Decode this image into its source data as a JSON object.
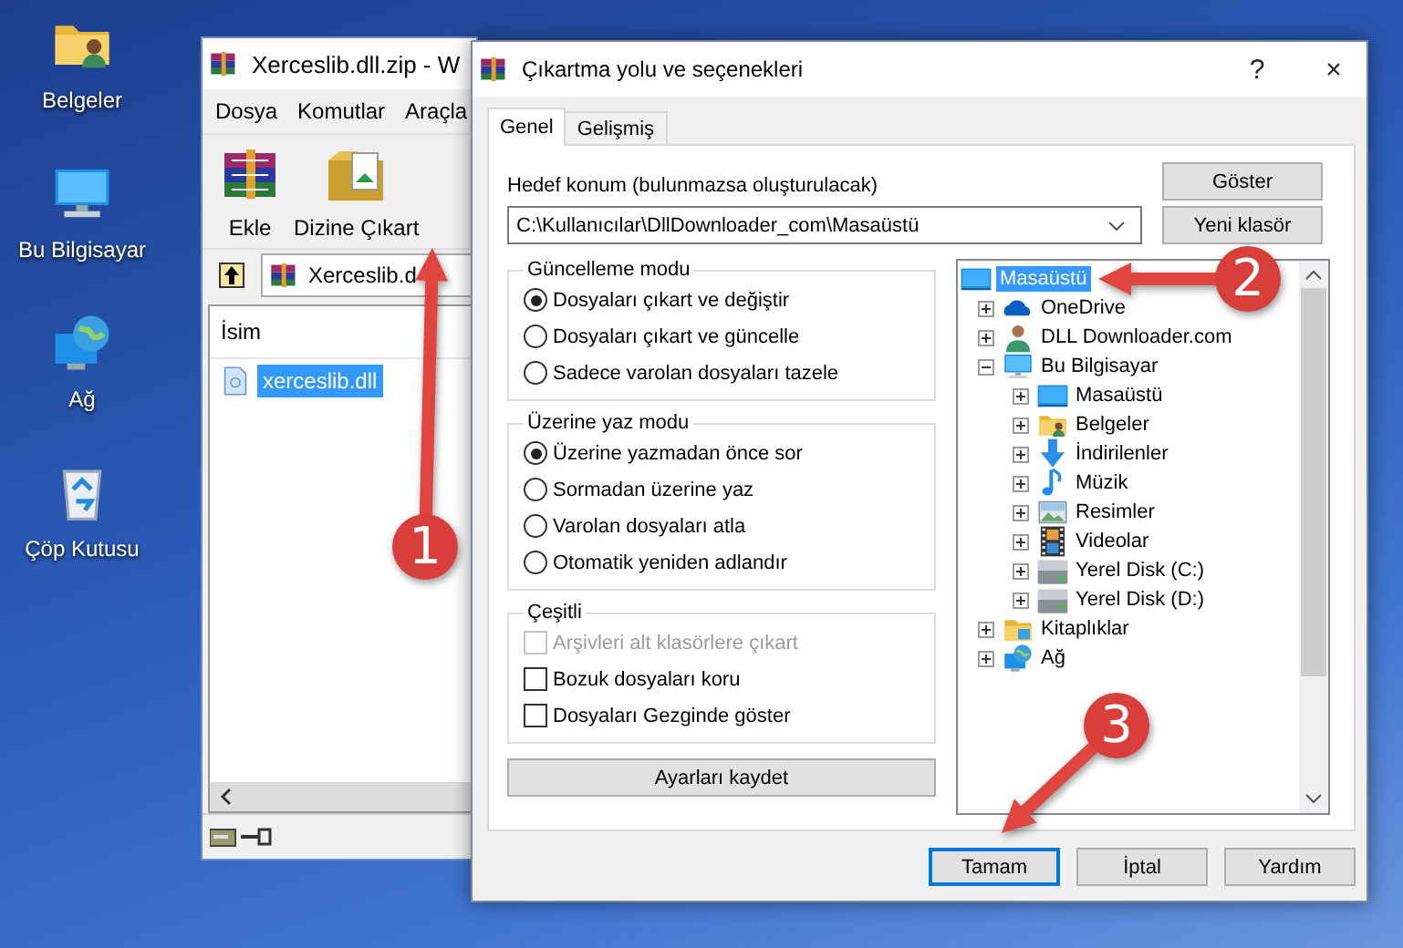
{
  "desktop_icons": [
    {
      "label": "Belgeler",
      "kind": "documents"
    },
    {
      "label": "Bu Bilgisayar",
      "kind": "computer"
    },
    {
      "label": "Ağ",
      "kind": "network"
    },
    {
      "label": "Çöp Kutusu",
      "kind": "recycle"
    }
  ],
  "archive_window": {
    "title": "Xerceslib.dll.zip - W",
    "menu": [
      "Dosya",
      "Komutlar",
      "Araçla"
    ],
    "toolbar": [
      {
        "label": "Ekle",
        "kind": "add"
      },
      {
        "label": "Dizine Çıkart",
        "kind": "extract"
      }
    ],
    "address": "Xerceslib.d",
    "columns": [
      "İsim"
    ],
    "files": [
      {
        "name": "xerceslib.dll",
        "selected": true
      }
    ]
  },
  "dialog": {
    "title": "Çıkartma yolu ve seçenekleri",
    "help": "?",
    "close": "×",
    "tabs": [
      {
        "label": "Genel",
        "selected": true
      },
      {
        "label": "Gelişmiş",
        "selected": false
      }
    ],
    "destination_label": "Hedef konum (bulunmazsa oluşturulacak)",
    "destination": "C:\\Kullanıcılar\\DllDownloader_com\\Masaüstü",
    "side_buttons": [
      "Göster",
      "Yeni klasör"
    ],
    "groups": [
      {
        "title": "Güncelleme modu",
        "kind": "radio",
        "options": [
          {
            "label": "Dosyaları çıkart ve değiştir",
            "selected": true
          },
          {
            "label": "Dosyaları çıkart ve güncelle",
            "selected": false
          },
          {
            "label": "Sadece varolan dosyaları tazele",
            "selected": false
          }
        ]
      },
      {
        "title": "Üzerine yaz modu",
        "kind": "radio",
        "options": [
          {
            "label": "Üzerine yazmadan önce sor",
            "selected": true
          },
          {
            "label": "Sormadan üzerine yaz",
            "selected": false
          },
          {
            "label": "Varolan dosyaları atla",
            "selected": false
          },
          {
            "label": "Otomatik yeniden adlandır",
            "selected": false
          }
        ]
      },
      {
        "title": "Çeşitli",
        "kind": "checkbox",
        "options": [
          {
            "label": "Arşivleri alt klasörlere çıkart",
            "checked": false,
            "disabled": true
          },
          {
            "label": "Bozuk dosyaları koru",
            "checked": false,
            "disabled": false
          },
          {
            "label": "Dosyaları Gezginde göster",
            "checked": false,
            "disabled": false
          }
        ]
      }
    ],
    "save_button": "Ayarları kaydet",
    "tree": [
      {
        "label": "Masaüstü",
        "kind": "desktop",
        "selected": true,
        "children": [
          {
            "label": "OneDrive",
            "kind": "cloud",
            "selected": false,
            "expanded": false
          },
          {
            "label": "DLL Downloader.com",
            "kind": "user",
            "selected": false,
            "expanded": false
          },
          {
            "label": "Bu Bilgisayar",
            "kind": "computer",
            "selected": false,
            "expanded": true,
            "children": [
              {
                "label": "Masaüstü",
                "kind": "desktop",
                "selected": false,
                "expanded": false
              },
              {
                "label": "Belgeler",
                "kind": "documents",
                "selected": false,
                "expanded": false
              },
              {
                "label": "İndirilenler",
                "kind": "downloads",
                "selected": false,
                "expanded": false
              },
              {
                "label": "Müzik",
                "kind": "music",
                "selected": false,
                "expanded": false
              },
              {
                "label": "Resimler",
                "kind": "pictures",
                "selected": false,
                "expanded": false
              },
              {
                "label": "Videolar",
                "kind": "videos",
                "selected": false,
                "expanded": false
              },
              {
                "label": "Yerel Disk (C:)",
                "kind": "disk",
                "selected": false,
                "expanded": false
              },
              {
                "label": "Yerel Disk (D:)",
                "kind": "disk",
                "selected": false,
                "expanded": false
              }
            ]
          },
          {
            "label": "Kitaplıklar",
            "kind": "library",
            "selected": false,
            "expanded": false
          },
          {
            "label": "Ağ",
            "kind": "network",
            "selected": false,
            "expanded": false
          }
        ]
      }
    ],
    "buttons": [
      {
        "label": "Tamam",
        "focused": true
      },
      {
        "label": "İptal",
        "focused": false
      },
      {
        "label": "Yardım",
        "focused": false
      }
    ]
  },
  "annotations": [
    {
      "number": "1"
    },
    {
      "number": "2"
    },
    {
      "number": "3"
    }
  ]
}
